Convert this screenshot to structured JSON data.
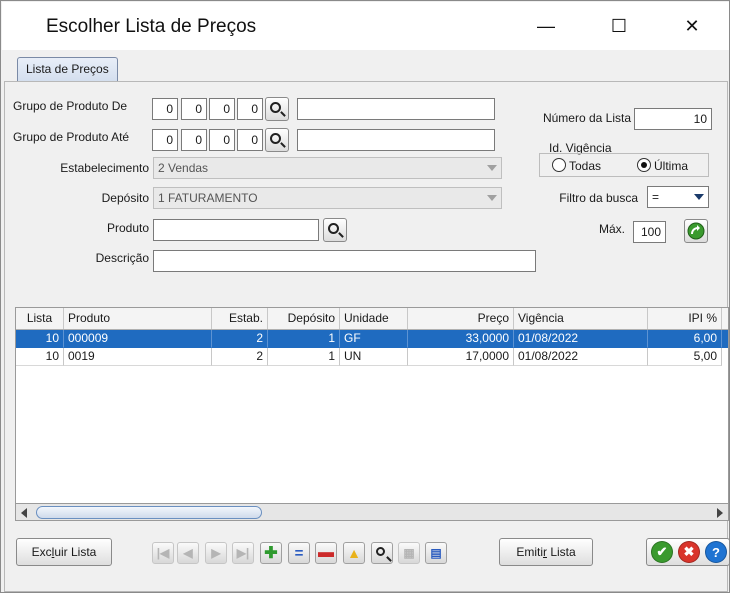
{
  "window": {
    "title": "Escolher Lista de Preços",
    "minimize": "—",
    "maximize": "☐",
    "close": "✕"
  },
  "tab": {
    "label": "Lista de Preços"
  },
  "form": {
    "grupo_de": {
      "label": "Grupo de Produto De",
      "parts": [
        "0",
        "0",
        "0",
        "0"
      ],
      "description": ""
    },
    "grupo_ate": {
      "label": "Grupo de Produto Até",
      "parts": [
        "0",
        "0",
        "0",
        "0"
      ],
      "description": ""
    },
    "estabelecimento": {
      "label": "Estabelecimento",
      "value": "2 Vendas"
    },
    "deposito": {
      "label": "Depósito",
      "value": "1 FATURAMENTO"
    },
    "produto": {
      "label": "Produto",
      "value": ""
    },
    "descricao": {
      "label": "Descrição",
      "value": ""
    },
    "numero_lista": {
      "label": "Número da Lista",
      "value": "10"
    },
    "vigencia": {
      "label": "Id. Vigência",
      "option_all": "Todas",
      "option_last": "Última",
      "selected": "Última"
    },
    "filtro": {
      "label": "Filtro da busca",
      "value": "="
    },
    "max": {
      "label": "Máx.",
      "value": "100"
    }
  },
  "grid": {
    "columns": [
      "Lista",
      "Produto",
      "Estab.",
      "Depósito",
      "Unidade",
      "Preço",
      "Vigência",
      "IPI %"
    ],
    "rows": [
      {
        "lista": "10",
        "produto": "000009",
        "estab": "2",
        "deposito": "1",
        "unidade": "GF",
        "preco": "33,0000",
        "vigencia": "01/08/2022",
        "ipi": "6,00",
        "selected": true
      },
      {
        "lista": "10",
        "produto": "0019",
        "estab": "2",
        "deposito": "1",
        "unidade": "UN",
        "preco": "17,0000",
        "vigencia": "01/08/2022",
        "ipi": "5,00",
        "selected": false
      }
    ]
  },
  "footer": {
    "excluir": {
      "pre": "Exc",
      "key": "l",
      "post": "uir Lista"
    },
    "emitir": {
      "pre": "Emiti",
      "key": "r",
      "post": " Lista"
    }
  },
  "colors": {
    "selection": "#1f6bc0",
    "ok": "#3a9a2e",
    "cancel": "#d9342b",
    "help": "#1e73d2",
    "add": "#2e9a2e",
    "equal": "#2a5bc0",
    "remove": "#cc2a2a",
    "warn": "#e9b21a"
  }
}
